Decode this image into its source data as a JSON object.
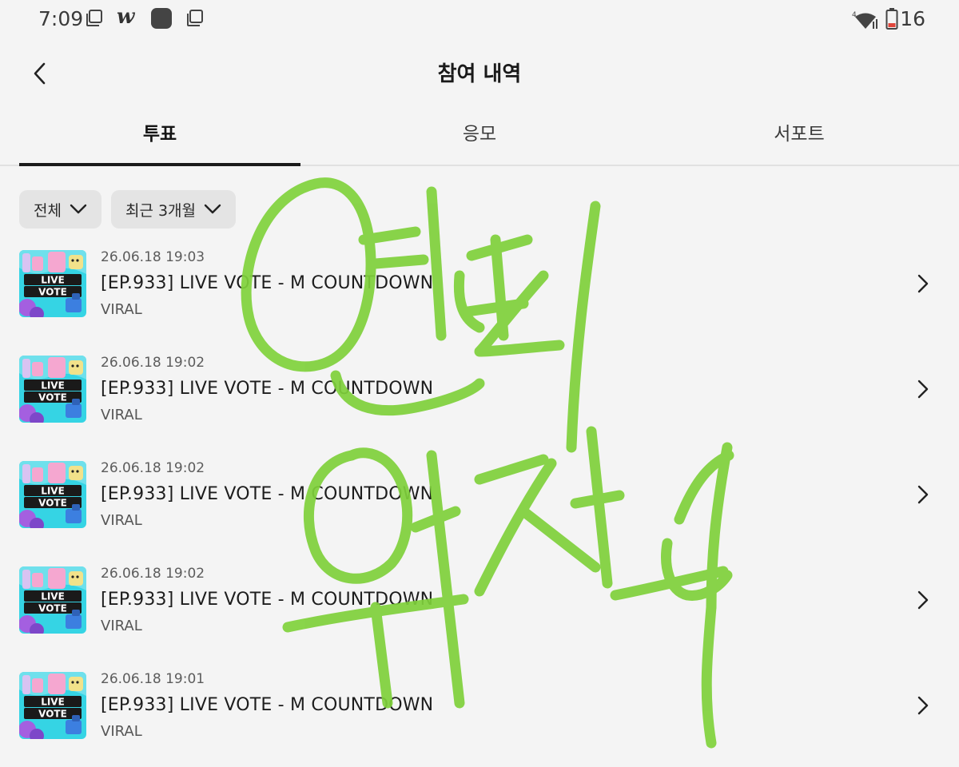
{
  "status_bar": {
    "time": "7:09",
    "app_letter": "w",
    "battery": "16",
    "icons": [
      "copy-icon",
      "weverse-icon",
      "app-square-icon",
      "copy-icon",
      "wifi-icon",
      "battery-icon"
    ]
  },
  "header": {
    "title": "참여 내역",
    "back_icon": "chevron-left-icon"
  },
  "tabs": [
    {
      "label": "투표",
      "active": true
    },
    {
      "label": "응모",
      "active": false
    },
    {
      "label": "서포트",
      "active": false
    }
  ],
  "filters": [
    {
      "label": "전체",
      "icon": "chevron-down-icon"
    },
    {
      "label": "최근 3개월",
      "icon": "chevron-down-icon"
    }
  ],
  "thumbnail": {
    "line1": "LIVE",
    "line2": "VOTE",
    "colors": {
      "background": "#35d4e4",
      "accent": "#a45fe0",
      "pink": "#f5a7d0",
      "yellow": "#f2e28a",
      "blue": "#3c7fe0"
    }
  },
  "items": [
    {
      "date": "26.06.18 19:03",
      "title": "[EP.933] LIVE VOTE - M COUNTDOWN",
      "subtitle": "VIRAL"
    },
    {
      "date": "26.06.18 19:02",
      "title": "[EP.933] LIVE VOTE - M COUNTDOWN",
      "subtitle": "VIRAL"
    },
    {
      "date": "26.06.18 19:02",
      "title": "[EP.933] LIVE VOTE - M COUNTDOWN",
      "subtitle": "VIRAL"
    },
    {
      "date": "26.06.18 19:02",
      "title": "[EP.933] LIVE VOTE - M COUNTDOWN",
      "subtitle": "VIRAL"
    },
    {
      "date": "26.06.18 19:01",
      "title": "[EP.933] LIVE VOTE - M COUNTDOWN",
      "subtitle": "VIRAL"
    }
  ],
  "colors": {
    "background": "#f4f4f4",
    "scribble": "#7fd13b",
    "chip": "#e4e4e4"
  }
}
